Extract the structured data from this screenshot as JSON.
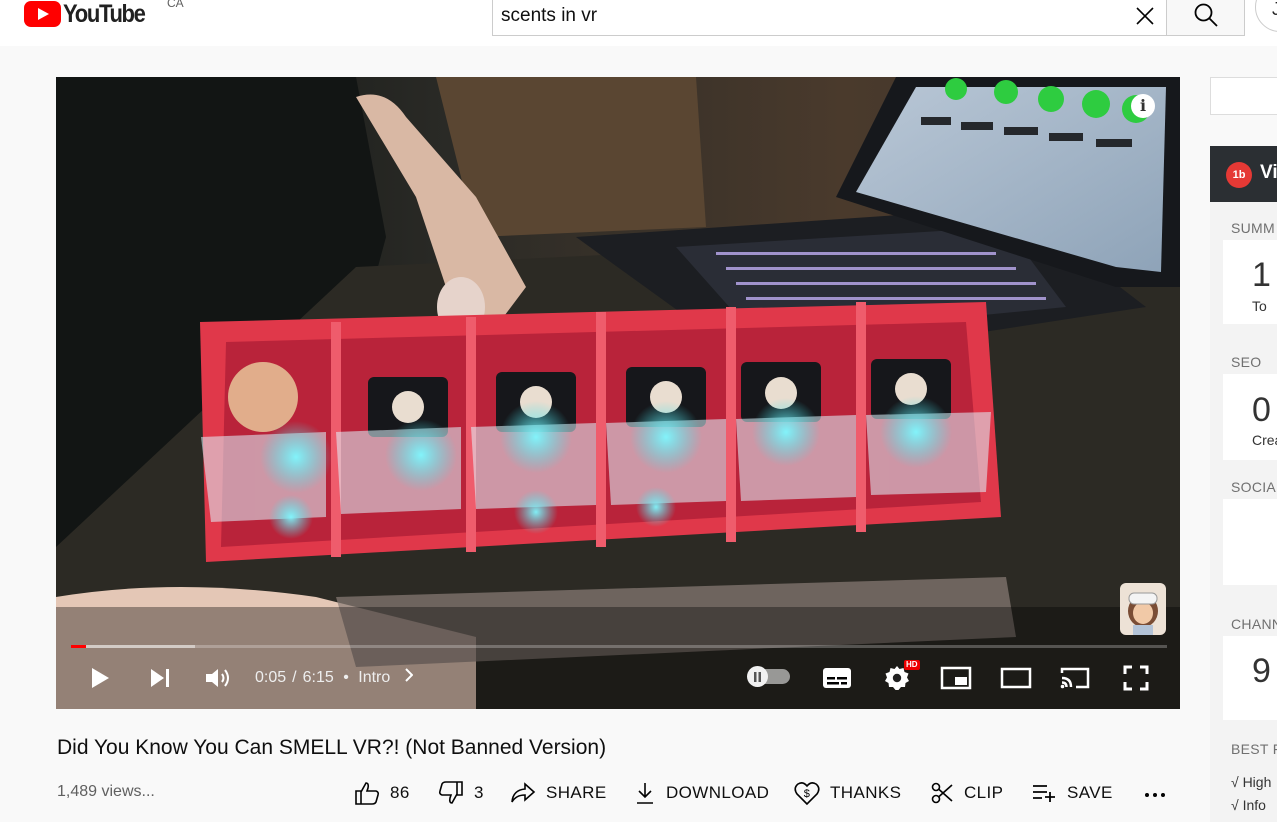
{
  "header": {
    "logo_text": "YouTube",
    "country_code": "CA",
    "search_value": "scents in vr",
    "account_initial": "J"
  },
  "player": {
    "current_time": "0:05",
    "duration": "6:15",
    "chapter": "Intro",
    "progress_fraction": 0.0137,
    "buffered_fraction": 0.113,
    "hd_badge": "HD",
    "info_glyph": "i"
  },
  "video": {
    "title": "Did You Know You Can SMELL VR?! (Not Banned Version)",
    "views": "1,489 views..."
  },
  "actions": {
    "like_count": "86",
    "dislike_count": "3",
    "share_label": "SHARE",
    "download_label": "DOWNLOAD",
    "thanks_label": "THANKS",
    "clip_label": "CLIP",
    "save_label": "SAVE"
  },
  "sidebar": {
    "vidiq_logo": "1b",
    "vidiq_title": "Vi",
    "summary_label": "SUMM",
    "summary_value": "1",
    "summary_sub": "To",
    "seo_label": "SEO",
    "seo_value": "0",
    "seo_sub": "Creat",
    "social_label": "SOCIA",
    "channel_label": "CHANN",
    "channel_value": "9",
    "best_label": "BEST F",
    "checks": [
      "√ High",
      "√ Info"
    ]
  }
}
